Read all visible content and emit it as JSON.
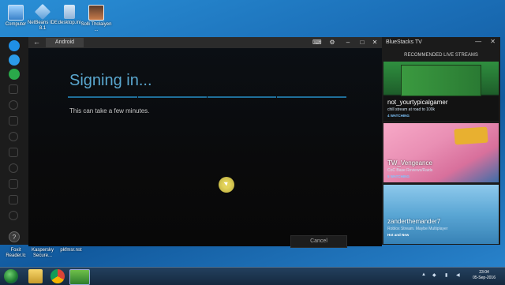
{
  "desktop": {
    "icons": [
      {
        "label": "Computer",
        "name": "computer"
      },
      {
        "label": "NetBeans IDE 8.1",
        "name": "netbeans"
      },
      {
        "label": "desktop.ini",
        "name": "desktop-ini"
      },
      {
        "label": "Solli Tholaiyen ...",
        "name": "solli-tholaiyen"
      }
    ],
    "bottom_icons": [
      {
        "label": "Foxit Reader.lc",
        "name": "foxit"
      },
      {
        "label": "Kaspersky Secure...",
        "name": "kaspersky"
      },
      {
        "label": "pkfmsr.nst",
        "name": "pkfmsr"
      }
    ]
  },
  "main_window": {
    "back_glyph": "←",
    "tab_label": "Android",
    "title": "Signing in...",
    "subtitle": "This can take a few minutes.",
    "cancel_label": "Cancel"
  },
  "tv": {
    "title": "BlueStacks TV",
    "header": "RECOMMENDED LIVE STREAMS",
    "streams": [
      {
        "name": "not_yourtypicalgamer",
        "desc": "chill stream at road to 100k",
        "watching": "4 WATCHING"
      },
      {
        "name": "TW_Vengeance",
        "desc": "CoC Base Reviews/Raids",
        "watching": "5 WATCHING"
      },
      {
        "name": "zanderthemander7",
        "desc": "Roblox Stream. Maybe Multiplayer",
        "watching": "Hot and New"
      }
    ]
  },
  "taskbar": {
    "time": "23:04",
    "date": "05-Sep-2016"
  },
  "colors": {
    "accent": "#5aa7cf",
    "desktop_blue": "#1b6fb8"
  }
}
